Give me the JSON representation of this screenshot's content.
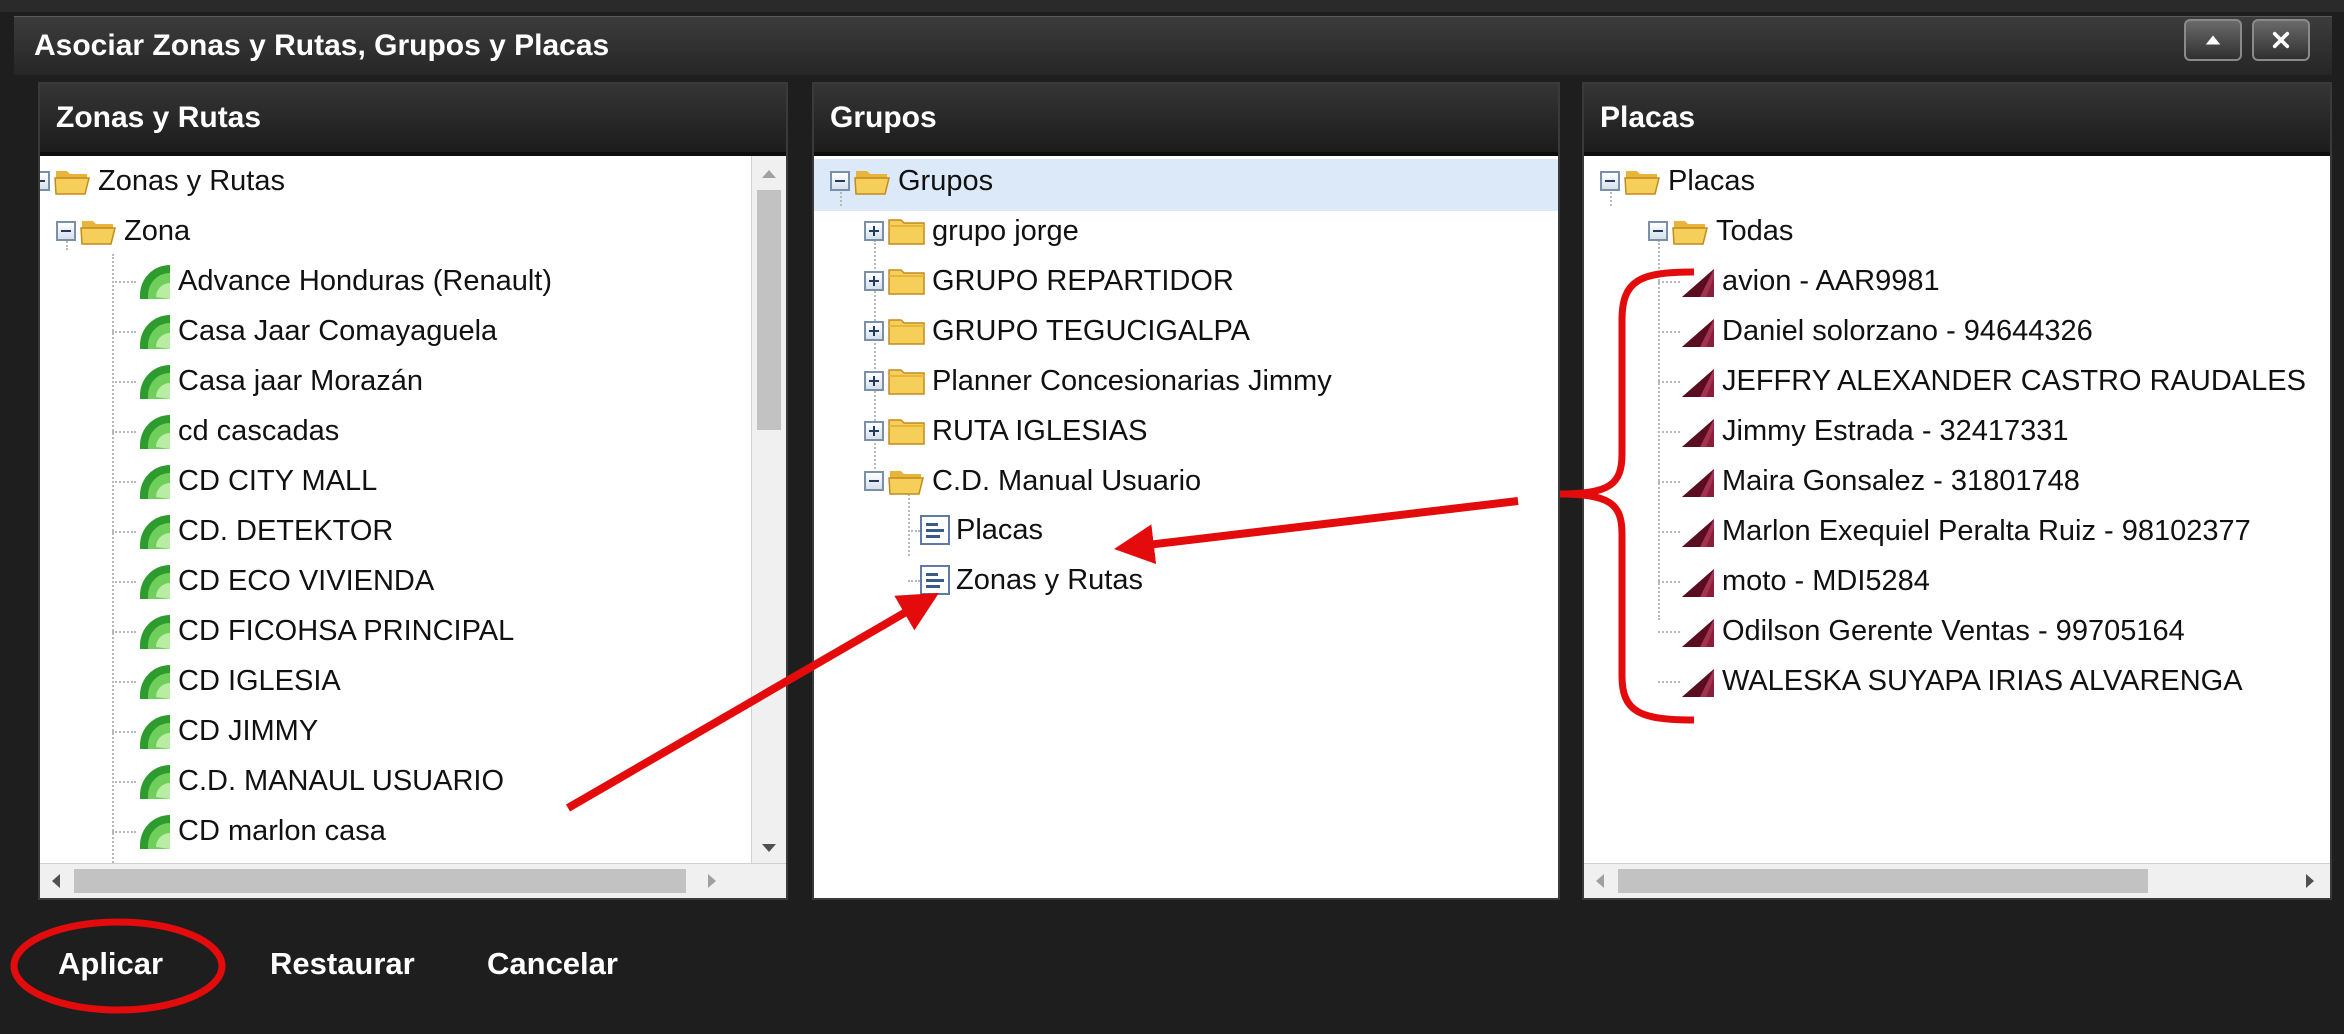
{
  "window": {
    "title": "Asociar Zonas y Rutas, Grupos y Placas",
    "buttons": {
      "minimize_icon": "triangle-up-icon",
      "close_icon": "x-icon"
    }
  },
  "panels": {
    "zonas": {
      "header": "Zonas y Rutas",
      "root": "Zonas y Rutas",
      "zona": "Zona",
      "items": [
        "Advance Honduras (Renault)",
        "Casa Jaar Comayaguela",
        "Casa jaar Morazán",
        "cd cascadas",
        "CD CITY MALL",
        "CD. DETEKTOR",
        "CD ECO VIVIENDA",
        "CD FICOHSA PRINCIPAL",
        "CD IGLESIA",
        "CD JIMMY",
        "C.D. MANAUL USUARIO",
        "CD marlon casa"
      ]
    },
    "grupos": {
      "header": "Grupos",
      "root": "Grupos",
      "groups": [
        "grupo jorge",
        "GRUPO REPARTIDOR",
        "GRUPO TEGUCIGALPA",
        "Planner Concesionarias Jimmy",
        "RUTA IGLESIAS",
        "C.D. Manual Usuario"
      ],
      "children": [
        "Placas",
        "Zonas y Rutas"
      ]
    },
    "placas": {
      "header": "Placas",
      "root": "Placas",
      "todas": "Todas",
      "items": [
        "avion - AAR9981",
        "Daniel solorzano - 94644326",
        "JEFFRY ALEXANDER CASTRO RAUDALES",
        "Jimmy Estrada - 32417331",
        "Maira Gonsalez - 31801748",
        "Marlon Exequiel Peralta Ruiz - 98102377",
        "moto - MDI5284",
        "Odilson Gerente Ventas - 99705164",
        "WALESKA SUYAPA IRIAS ALVARENGA"
      ]
    }
  },
  "footer": {
    "apply": "Aplicar",
    "restore": "Restaurar",
    "cancel": "Cancelar"
  },
  "colors": {
    "annotation": "#e30b0b",
    "header_bg": "#262626",
    "selection": "#dce9f9"
  }
}
